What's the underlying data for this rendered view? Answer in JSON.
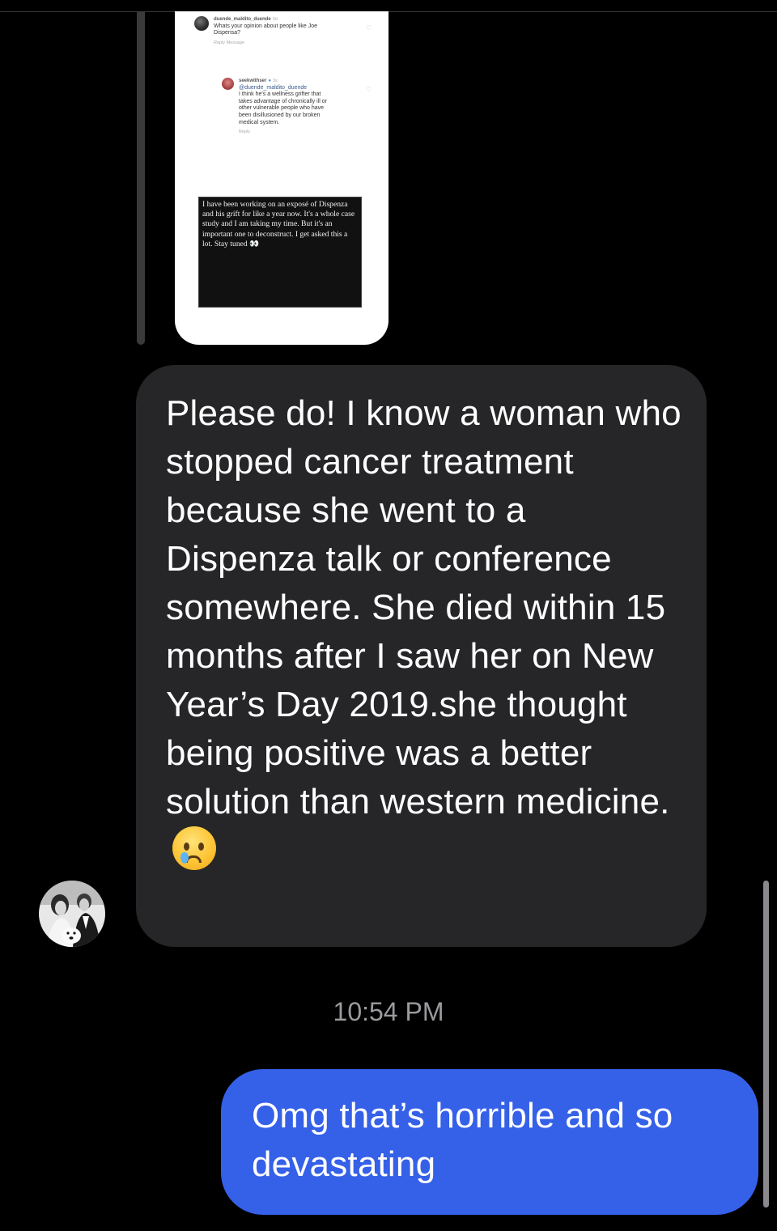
{
  "shared_story": {
    "comment1": {
      "username": "duende_maldito_duende",
      "age": "3d",
      "text": "Whats your opinion about people like Joe Dispensa?",
      "actions": "Reply   Message"
    },
    "comment2": {
      "username": "seekwithser",
      "age": "3s",
      "mention": "@duende_maldito_duende",
      "text": "I think he's a wellness grifter that takes advantage of chronically ill or other vulnerable people who have been disillusioned by our broken medical system.",
      "actions": "Reply"
    },
    "quote": "I have been working on an exposé of Dispenza and his grift for like a year now. It's a whole case study and I am taking my time. But it's an important one to deconstruct. I get asked this a lot. Stay tuned 👀"
  },
  "received_message": {
    "text": "Please do! I know a woman who stopped cancer treatment because she went to a Dispenza talk or conference somewhere. She died within 15 months after I saw her on New Year’s Day 2019.she thought being positive was a better solution than western medicine.",
    "emoji": "crying-face"
  },
  "timestamp": "10:54 PM",
  "sent_message": {
    "text": "Omg that’s horrible and so devastating"
  }
}
